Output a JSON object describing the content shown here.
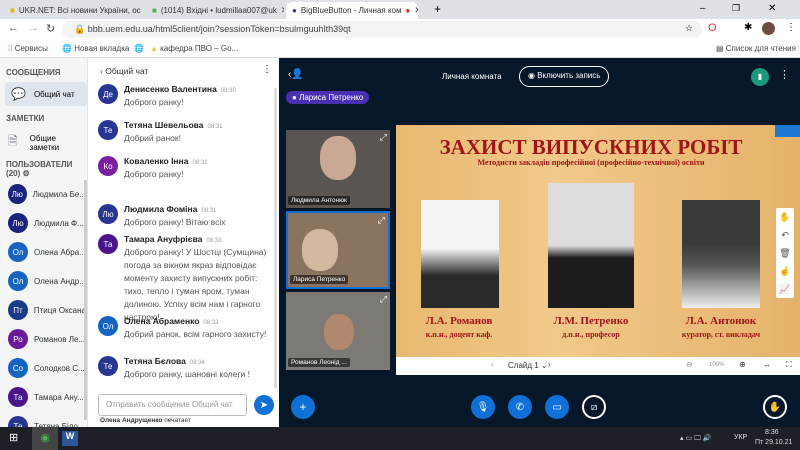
{
  "browser": {
    "tabs": [
      {
        "title": "UKR.NET: Всі новини України, ос"
      },
      {
        "title": "(1014) Вхідні • ludmillaa007@uk"
      },
      {
        "title": "BigBlueButton - Личная ком"
      }
    ],
    "url": "bbb.uem.edu.ua/html5client/join?sessionToken=bsulmguuhlth39qt",
    "bookmarks": [
      "Сервисы",
      "Новая вкладка",
      "кафедра ПВО – Go..."
    ],
    "reading_list": "Список для чтения"
  },
  "sidebar": {
    "messages_header": "СООБЩЕНИЯ",
    "public_chat": "Общий чат",
    "notes_header": "ЗАМЕТКИ",
    "shared_notes": "Общие заметки",
    "users_header": "ПОЛЬЗОВАТЕЛИ (20)",
    "users": [
      {
        "initials": "Лю",
        "name": "Людмила Бе...",
        "color": "#1a237e"
      },
      {
        "initials": "Лю",
        "name": "Людмила Ф...",
        "color": "#1a237e"
      },
      {
        "initials": "Ол",
        "name": "Олена Абра...",
        "color": "#1565c0"
      },
      {
        "initials": "Ол",
        "name": "Олена Андр...",
        "color": "#1565c0"
      },
      {
        "initials": "Пт",
        "name": "Птиця Оксана",
        "color": "#1a3a8a"
      },
      {
        "initials": "Ро",
        "name": "Романов Ле...",
        "color": "#6a1b9a"
      },
      {
        "initials": "Со",
        "name": "Солодков С...",
        "color": "#1565c0"
      },
      {
        "initials": "Та",
        "name": "Тамара Ану...",
        "color": "#4a148c"
      },
      {
        "initials": "Те",
        "name": "Тетяна Біло...",
        "color": "#283593"
      }
    ]
  },
  "chat": {
    "title": "Общий чат",
    "messages": [
      {
        "initials": "Де",
        "name": "Денисенко Валентина",
        "time": "08:30",
        "text": "Доброго ранку!",
        "color": "#283593"
      },
      {
        "initials": "Те",
        "name": "Тетяна Шевельова",
        "time": "08:31",
        "text": "Добрий ранок!",
        "color": "#283593"
      },
      {
        "initials": "Ко",
        "name": "Коваленко Інна",
        "time": "08:31",
        "text": "Доброго ранку!",
        "color": "#7b1fa2"
      },
      {
        "initials": "Лю",
        "name": "Людмила Фоміна",
        "time": "08:31",
        "text": "Доброго ранку! Вітаю всіх",
        "color": "#283593"
      },
      {
        "initials": "Та",
        "name": "Тамара Ануфрієва",
        "time": "08:33",
        "text": "Доброго ранку! У Шостці (Сумщина) погода за вікном якраз відповідає моменту захисту випускних робіт: тихо, тепло і туман яром, туман долиною. Успіху всім нам і гарного настрою!",
        "color": "#4a148c"
      },
      {
        "initials": "Ол",
        "name": "Олена Абраменко",
        "time": "08:33",
        "text": "Добрий ранок, всім гарного захисту!",
        "color": "#1565c0"
      },
      {
        "initials": "Те",
        "name": "Тетяна Бєлова",
        "time": "08:34",
        "text": "Доброго ранку, шановні колеги !",
        "color": "#283593"
      }
    ],
    "placeholder": "Отправить сообщение Общий чат",
    "typing_user": "Олена Андрущенко",
    "typing_suffix": "печатает"
  },
  "meeting": {
    "room": "Личная комната",
    "record": "Включить запись",
    "talker": "Лариса Петренко",
    "videos": [
      "Людмила Антонюк",
      "Лариса Петренко",
      "Романов Леонід ..."
    ],
    "slide": {
      "title": "ЗАХИСТ ВИПУСКНИХ РОБІТ",
      "subtitle": "Методисти закладів професійної (професійно-технічної) освіти",
      "people": [
        {
          "name": "Л.А. Романов",
          "role": "к.п.н., доцент каф."
        },
        {
          "name": "Л.М. Петренко",
          "role": "д.п.н., професор"
        },
        {
          "name": "Л.А. Антонюк",
          "role": "куратор, ст. викладач"
        }
      ]
    },
    "slide_label": "Слайд 1",
    "zoom": "100%"
  },
  "taskbar": {
    "lang": "УКР",
    "time": "8:36",
    "date": "Пт 29.10.21"
  }
}
